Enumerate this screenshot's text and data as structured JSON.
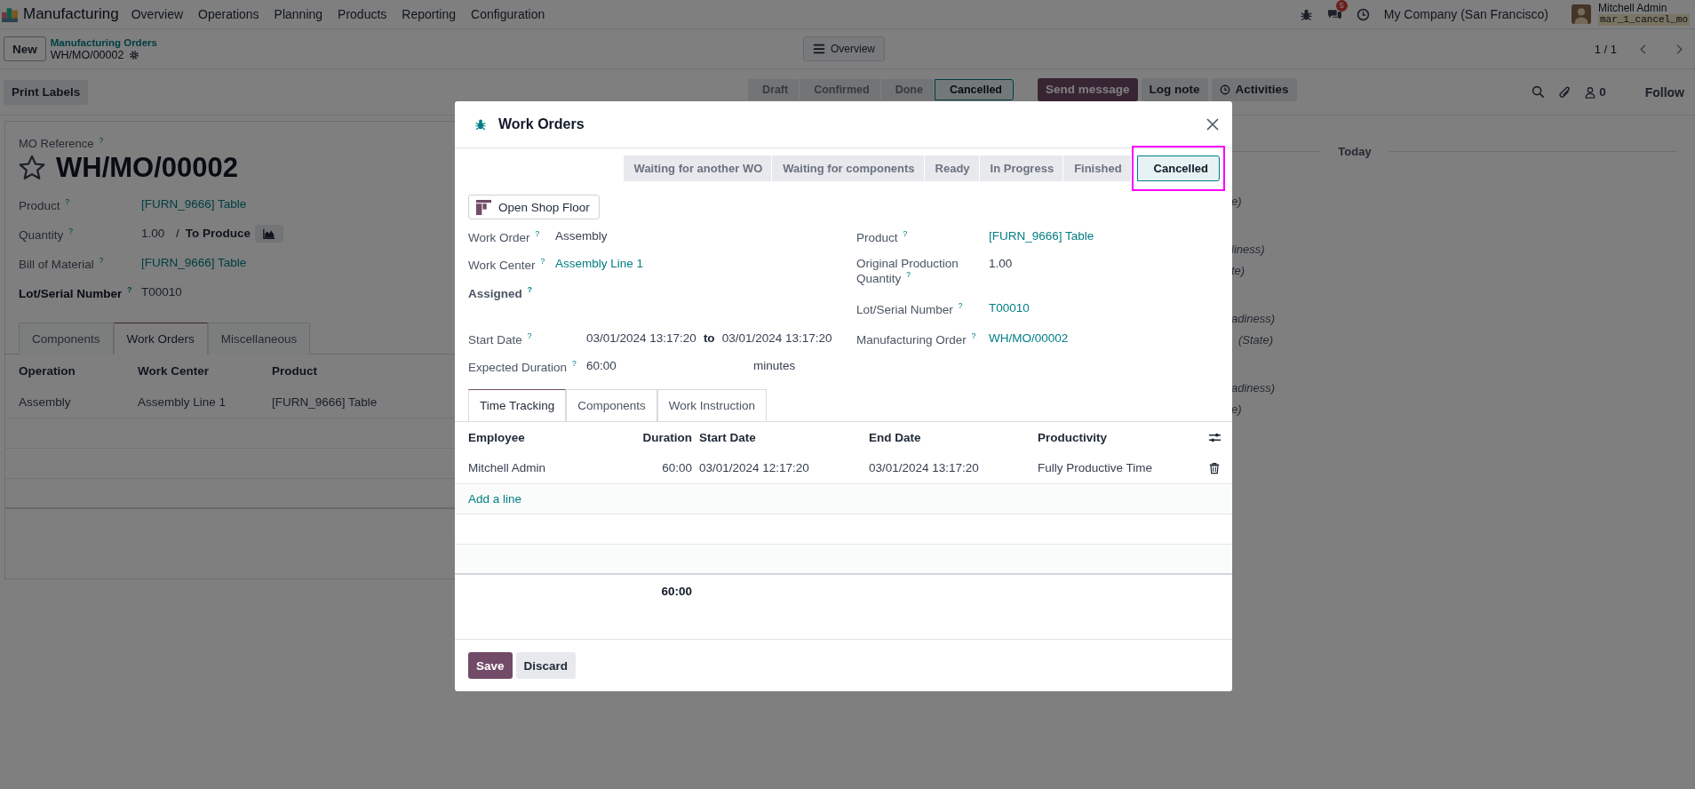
{
  "navbar": {
    "app": "Manufacturing",
    "menu": [
      "Overview",
      "Operations",
      "Planning",
      "Products",
      "Reporting",
      "Configuration"
    ],
    "message_count": "5",
    "company": "My Company (San Francisco)",
    "user": {
      "name": "Mitchell Admin",
      "database": "mar_1_cancel_mo"
    }
  },
  "control_panel": {
    "new_button": "New",
    "breadcrumb": {
      "parent": "Manufacturing Orders",
      "current": "WH/MO/00002"
    },
    "overview_button": "Overview",
    "pager": "1 / 1"
  },
  "action_bar": {
    "buttons": [
      "Print Labels"
    ],
    "status_steps": [
      {
        "label": "Draft",
        "selected": false
      },
      {
        "label": "Confirmed",
        "selected": false
      },
      {
        "label": "Done",
        "selected": false
      },
      {
        "label": "Cancelled",
        "selected": true
      }
    ],
    "chatter_buttons": [
      {
        "label": "Send message",
        "kind": "primary"
      },
      {
        "label": "Log note",
        "kind": "secondary"
      },
      {
        "label": "Activities",
        "kind": "activities"
      }
    ],
    "follower_count": "0",
    "follow": "Follow"
  },
  "form": {
    "reference_label": "MO Reference $^{?}$",
    "reference": "WH/MO/00002",
    "starred": false,
    "fields": [
      {
        "label": "Product $^{?}$",
        "value": "[FURN_9666] Table",
        "kind": "link",
        "bold": false
      },
      {
        "label": "Quantity $^{?}$",
        "value": "1.00",
        "separator": "/",
        "unit": "To Produce",
        "kind": "quantity",
        "bold": false
      },
      {
        "label": "Bill of Material $^{?}$",
        "value": "[FURN_9666] Table",
        "kind": "link",
        "bold": false
      },
      {
        "label": "Lot/Serial Number $^{?}$",
        "value": "T00010",
        "kind": "text",
        "bold": true
      }
    ],
    "tabs": [
      {
        "label": "Components",
        "selected": false
      },
      {
        "label": "Work Orders",
        "selected": true
      },
      {
        "label": "Miscellaneous",
        "selected": false
      }
    ],
    "table": {
      "columns": [
        "Operation",
        "Work Center",
        "Product"
      ],
      "rows": [
        [
          "Assembly",
          "Assembly Line 1",
          "[FURN_9666] Table"
        ]
      ]
    }
  },
  "chatter": {
    "divider": "Today",
    "messages": [
      {
        "lines": [
          {
            "text": "e)",
            "kind": "cut"
          }
        ]
      },
      {
        "lines": [
          {
            "text": "liness)",
            "kind": "cut"
          },
          {
            "text": "te)",
            "kind": "cut"
          }
        ]
      },
      {
        "lines": [
          {
            "text": "adiness)",
            "kind": "cut"
          },
          {
            "text": "(State)",
            "kind": "whole"
          }
        ]
      },
      {
        "lines": [
          {
            "text": "adiness)",
            "kind": "cut"
          },
          {
            "text": "e)",
            "kind": "cut"
          }
        ]
      }
    ]
  },
  "dialog": {
    "title": "Work Orders",
    "status_steps": [
      {
        "label": "Waiting for another WO",
        "selected": false,
        "highlighted": false
      },
      {
        "label": "Waiting for components",
        "selected": false,
        "highlighted": false
      },
      {
        "label": "Ready",
        "selected": false,
        "highlighted": false
      },
      {
        "label": "In Progress",
        "selected": false,
        "highlighted": false
      },
      {
        "label": "Finished",
        "selected": false,
        "highlighted": false
      },
      {
        "label": "Cancelled",
        "selected": true,
        "highlighted": true
      }
    ],
    "shop_floor_button": "Open Shop Floor",
    "left_fields": [
      {
        "label": "Work Order $^{?}$",
        "value": "Assembly",
        "kind": "text",
        "bold": false
      },
      {
        "label": "Work Center $^{?}$",
        "value": "Assembly Line 1",
        "kind": "link",
        "bold": false
      },
      {
        "label": "Assigned $^{?}$",
        "kind": "empty",
        "bold": true
      },
      {
        "label": "Start Date $^{?}$",
        "value": "03/01/2024 13:17:20",
        "separator": "to",
        "value_end": "03/01/2024 13:17:20",
        "kind": "range",
        "bold": false
      },
      {
        "label": "Expected Duration $^{?}$",
        "value": "60:00",
        "unit": "minutes",
        "kind": "duration",
        "bold": false
      }
    ],
    "right_fields": [
      {
        "label": "Product $^{?}$",
        "value": "[FURN_9666] Table",
        "kind": "link",
        "bold": false
      },
      {
        "label": "Original Production Quantity $^{?}$",
        "value": "1.00",
        "kind": "text",
        "bold": false
      },
      {
        "label": "Lot/Serial Number $^{?}$",
        "value": "T00010",
        "kind": "link",
        "bold": false
      },
      {
        "label": "Manufacturing Order $^{?}$",
        "value": "WH/MO/00002",
        "kind": "link",
        "bold": false
      }
    ],
    "tabs": [
      {
        "label": "Time Tracking",
        "selected": true
      },
      {
        "label": "Components",
        "selected": false
      },
      {
        "label": "Work Instruction",
        "selected": false
      }
    ],
    "time_table": {
      "columns": [
        {
          "label": "Employee",
          "kind": "text"
        },
        {
          "label": "Duration",
          "kind": "number"
        },
        {
          "label": "Start Date",
          "kind": "text"
        },
        {
          "label": "End Date",
          "kind": "text"
        },
        {
          "label": "Productivity",
          "kind": "text"
        }
      ],
      "rows": [
        [
          "Mitchell Admin",
          "60:00",
          "03/01/2024 12:17:20",
          "03/01/2024 13:17:20",
          "Fully Productive Time"
        ]
      ],
      "add_line": "Add a line",
      "total": "60:00"
    },
    "buttons": [
      {
        "label": "Save",
        "kind": "primary"
      },
      {
        "label": "Discard",
        "kind": "secondary"
      }
    ]
  }
}
